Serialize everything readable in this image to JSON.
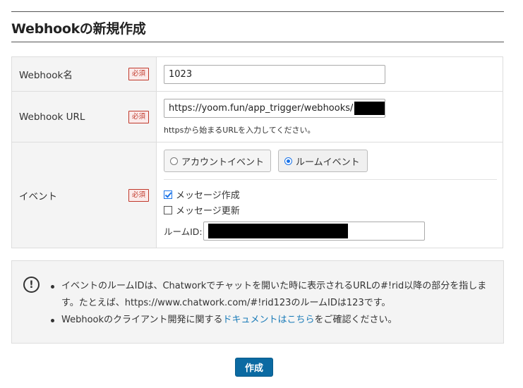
{
  "heading": "Webhookの新規作成",
  "form": {
    "required_badge": "必須",
    "name": {
      "label": "Webhook名",
      "value": "1023"
    },
    "url": {
      "label": "Webhook URL",
      "value": "https://yoom.fun/app_trigger/webhooks/",
      "help": "httpsから始まるURLを入力してください。"
    },
    "event": {
      "label": "イベント",
      "account_event": "アカウントイベント",
      "room_event": "ルームイベント",
      "selected": "room_event",
      "message_create": "メッセージ作成",
      "message_create_checked": true,
      "message_update": "メッセージ更新",
      "message_update_checked": false,
      "room_id_label": "ルームID:"
    }
  },
  "info": {
    "icon": "exclamation-circle-icon",
    "item1": "イベントのルームIDは、Chatworkでチャットを開いた時に表示されるURLの#!rid以降の部分を指します。たとえば、https://www.chatwork.com/#!rid123のルームIDは123です。",
    "item2_before": "Webhookのクライアント開発に関する",
    "item2_link": "ドキュメントはこちら",
    "item2_after": "をご確認ください。"
  },
  "submit_label": "作成",
  "colors": {
    "primary_button": "#0b6aa2",
    "link": "#1a7bb8",
    "required": "#c0392b"
  }
}
